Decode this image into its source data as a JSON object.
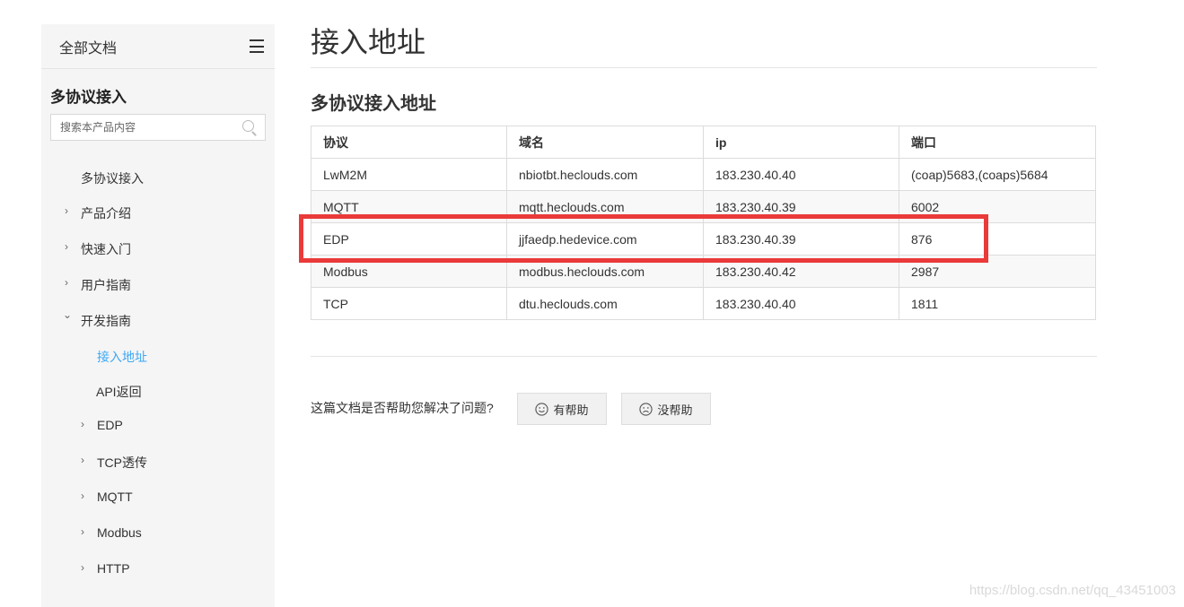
{
  "sidebar": {
    "all_docs_label": "全部文档",
    "section_title": "多协议接入",
    "search_placeholder": "搜索本产品内容",
    "items": [
      {
        "label": "多协议接入"
      },
      {
        "label": "产品介绍",
        "chevron": "›"
      },
      {
        "label": "快速入门",
        "chevron": "›"
      },
      {
        "label": "用户指南",
        "chevron": "›"
      },
      {
        "label": "开发指南",
        "chevron": "⌄"
      },
      {
        "label": "接入地址"
      },
      {
        "label": "API返回"
      },
      {
        "label": "EDP",
        "chevron": "›"
      },
      {
        "label": "TCP透传",
        "chevron": "›"
      },
      {
        "label": "MQTT",
        "chevron": "›"
      },
      {
        "label": "Modbus",
        "chevron": "›"
      },
      {
        "label": "HTTP",
        "chevron": "›"
      }
    ],
    "active_color": "#3da8f5"
  },
  "main": {
    "page_title": "接入地址",
    "section_title": "多协议接入地址",
    "table": {
      "headers": [
        "协议",
        "域名",
        "ip",
        "端口"
      ],
      "rows": [
        [
          "LwM2M",
          "nbiotbt.heclouds.com",
          "183.230.40.40",
          "(coap)5683,(coaps)5684"
        ],
        [
          "MQTT",
          "mqtt.heclouds.com",
          "183.230.40.39",
          "6002"
        ],
        [
          "EDP",
          "jjfaedp.hedevice.com",
          "183.230.40.39",
          "876"
        ],
        [
          "Modbus",
          "modbus.heclouds.com",
          "183.230.40.42",
          "2987"
        ],
        [
          "TCP",
          "dtu.heclouds.com",
          "183.230.40.40",
          "1811"
        ]
      ]
    },
    "highlight_color": "#ea3a3a",
    "feedback": {
      "question": "这篇文档是否帮助您解决了问题?",
      "helpful_label": "有帮助",
      "not_helpful_label": "没帮助"
    }
  },
  "watermark": "https://blog.csdn.net/qq_43451003"
}
